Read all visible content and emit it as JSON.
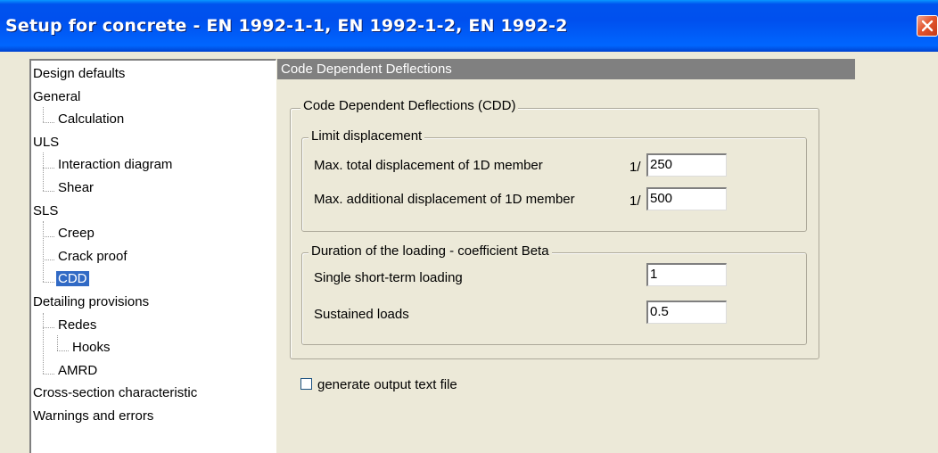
{
  "window": {
    "title": "Setup for concrete - EN 1992-1-1, EN 1992-1-2, EN 1992-2"
  },
  "tree": {
    "items": [
      {
        "label": "Design defaults",
        "level": 0
      },
      {
        "label": "General",
        "level": 0
      },
      {
        "label": "Calculation",
        "level": 1
      },
      {
        "label": "ULS",
        "level": 0
      },
      {
        "label": "Interaction diagram",
        "level": 1
      },
      {
        "label": "Shear",
        "level": 1
      },
      {
        "label": "SLS",
        "level": 0
      },
      {
        "label": "Creep",
        "level": 1
      },
      {
        "label": "Crack proof",
        "level": 1
      },
      {
        "label": "CDD",
        "level": 1,
        "selected": true
      },
      {
        "label": "Detailing provisions",
        "level": 0
      },
      {
        "label": "Redes",
        "level": 1
      },
      {
        "label": "Hooks",
        "level": 2
      },
      {
        "label": "AMRD",
        "level": 1
      },
      {
        "label": "Cross-section characteristic",
        "level": 0
      },
      {
        "label": "Warnings and errors",
        "level": 0
      }
    ]
  },
  "panel": {
    "header": "Code Dependent Deflections",
    "group_title": "Code Dependent Deflections (CDD)",
    "limit": {
      "title": "Limit displacement",
      "total_label": "Max. total displacement of 1D member",
      "total_prefix": "1/",
      "total_value": "250",
      "additional_label": "Max. additional displacement of 1D member",
      "additional_prefix": "1/",
      "additional_value": "500"
    },
    "duration": {
      "title": "Duration of the loading - coefficient Beta",
      "short_label": "Single short-term loading",
      "short_value": "1",
      "sustained_label": "Sustained loads",
      "sustained_value": "0.5"
    },
    "checkbox": {
      "label": "generate output text file",
      "checked": false
    }
  },
  "colors": {
    "selection": "#316ac5",
    "titlebar": "#0053ee",
    "dialog_bg": "#ece9d8",
    "header_bar": "#808080"
  }
}
